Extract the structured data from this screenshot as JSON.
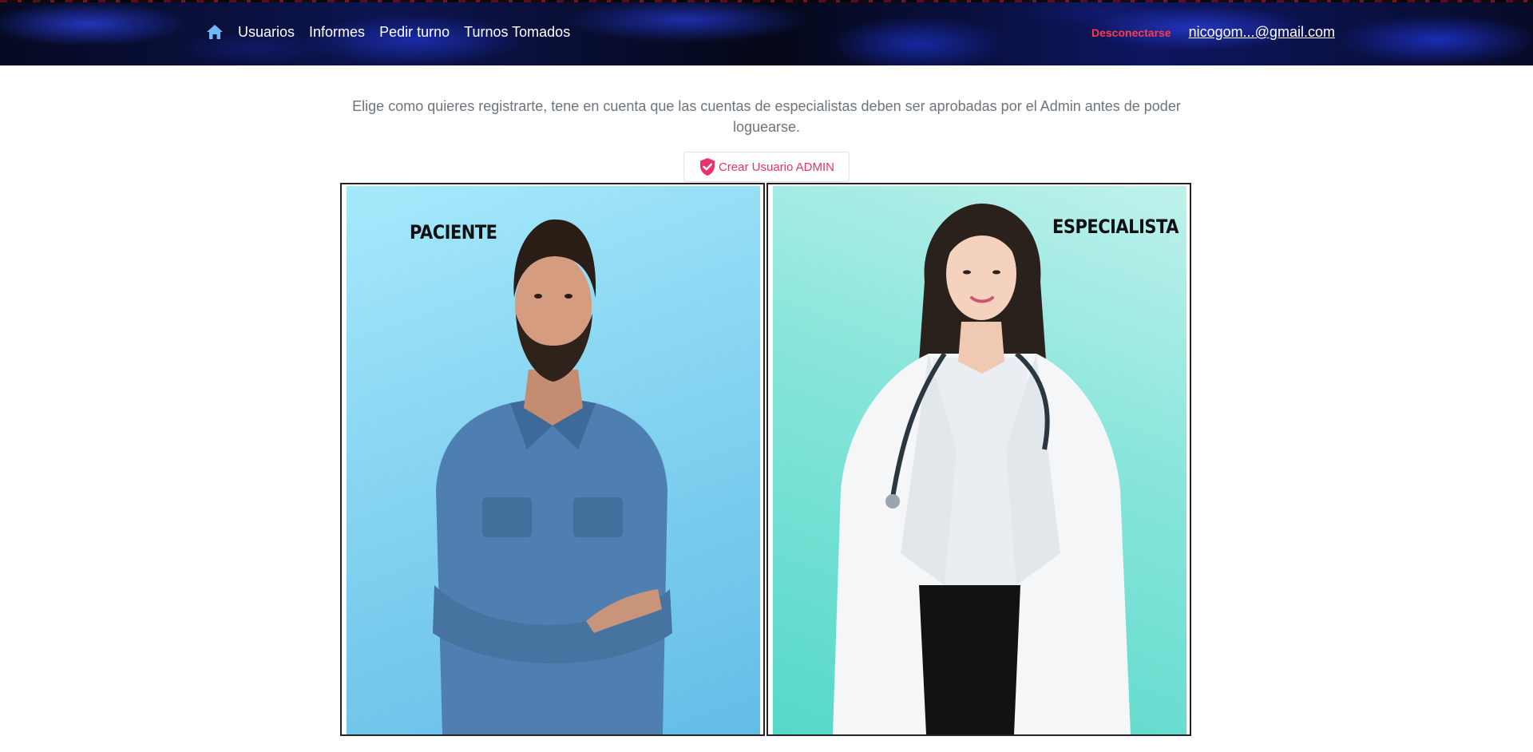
{
  "nav": {
    "home_icon": "home-icon",
    "links": [
      "Usuarios",
      "Informes",
      "Pedir turno",
      "Turnos Tomados"
    ],
    "logout_label": "Desconectarse",
    "user_email": "nicogom...@gmail.com",
    "colors": {
      "logout": "#ff3b4a",
      "home_icon": "#6fb8f5"
    }
  },
  "main": {
    "intro_text": "Elige como quieres registrarte, tene en cuenta que las cuentas de especialistas deben ser aprobadas por el Admin antes de poder loguearse.",
    "admin_button": {
      "label": "Crear Usuario ADMIN",
      "icon": "shield-check-icon",
      "color": "#e8336d"
    },
    "cards": [
      {
        "label": "PACIENTE"
      },
      {
        "label": "ESPECIALISTA"
      }
    ]
  }
}
